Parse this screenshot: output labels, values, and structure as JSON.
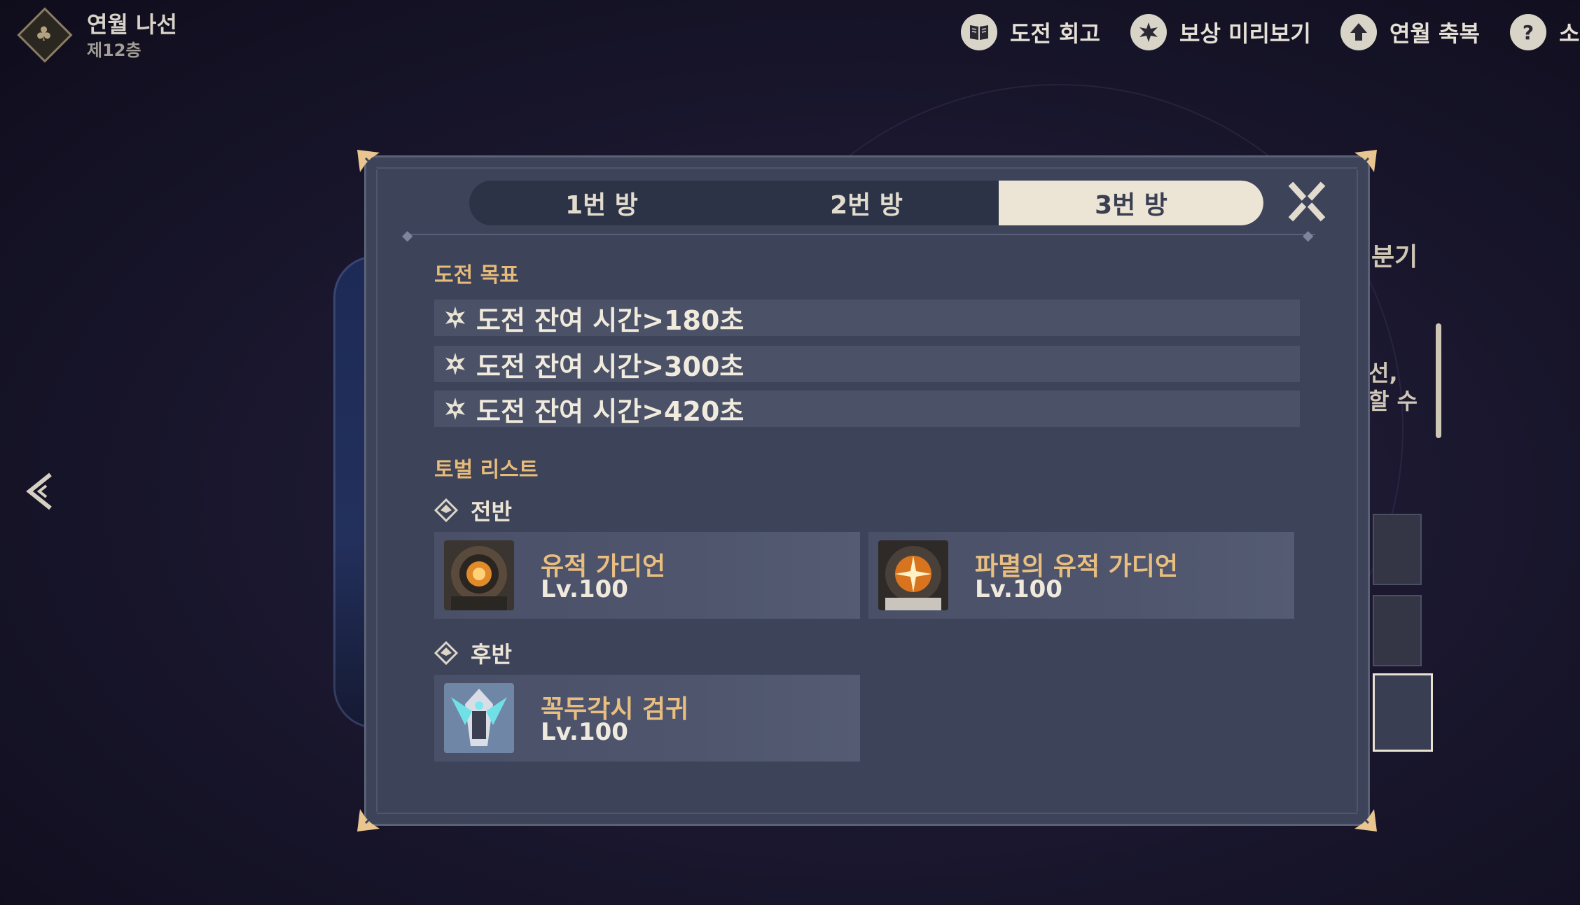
{
  "header": {
    "floor_title": "연월 나선",
    "floor_sub": "제12층",
    "buttons": [
      {
        "label": "도전 회고",
        "icon": "book-icon"
      },
      {
        "label": "보상 미리보기",
        "icon": "star-icon"
      },
      {
        "label": "연월 축복",
        "icon": "up-arrow-icon"
      },
      {
        "label": "소",
        "icon": "help-icon"
      }
    ]
  },
  "side": {
    "label_top": "분기",
    "text_line1": "선,",
    "text_line2": "할 수"
  },
  "dialog": {
    "tabs": [
      {
        "label": "1번 방",
        "active": false
      },
      {
        "label": "2번 방",
        "active": false
      },
      {
        "label": "3번 방",
        "active": true
      }
    ],
    "goals_title": "도전 목표",
    "goals": [
      "도전 잔여 시간>180초",
      "도전 잔여 시간>300초",
      "도전 잔여 시간>420초"
    ],
    "enemies_title": "토벌 리스트",
    "first_half_label": "전반",
    "second_half_label": "후반",
    "first_half": [
      {
        "name": "유적 가디언",
        "level": "Lv.100"
      },
      {
        "name": "파멸의 유적 가디언",
        "level": "Lv.100"
      }
    ],
    "second_half": [
      {
        "name": "꼭두각시 검귀",
        "level": "Lv.100"
      }
    ]
  },
  "colors": {
    "dialog_bg": "#3d4359",
    "accent_gold": "#e7bb79",
    "active_tab": "#ece5d6"
  }
}
